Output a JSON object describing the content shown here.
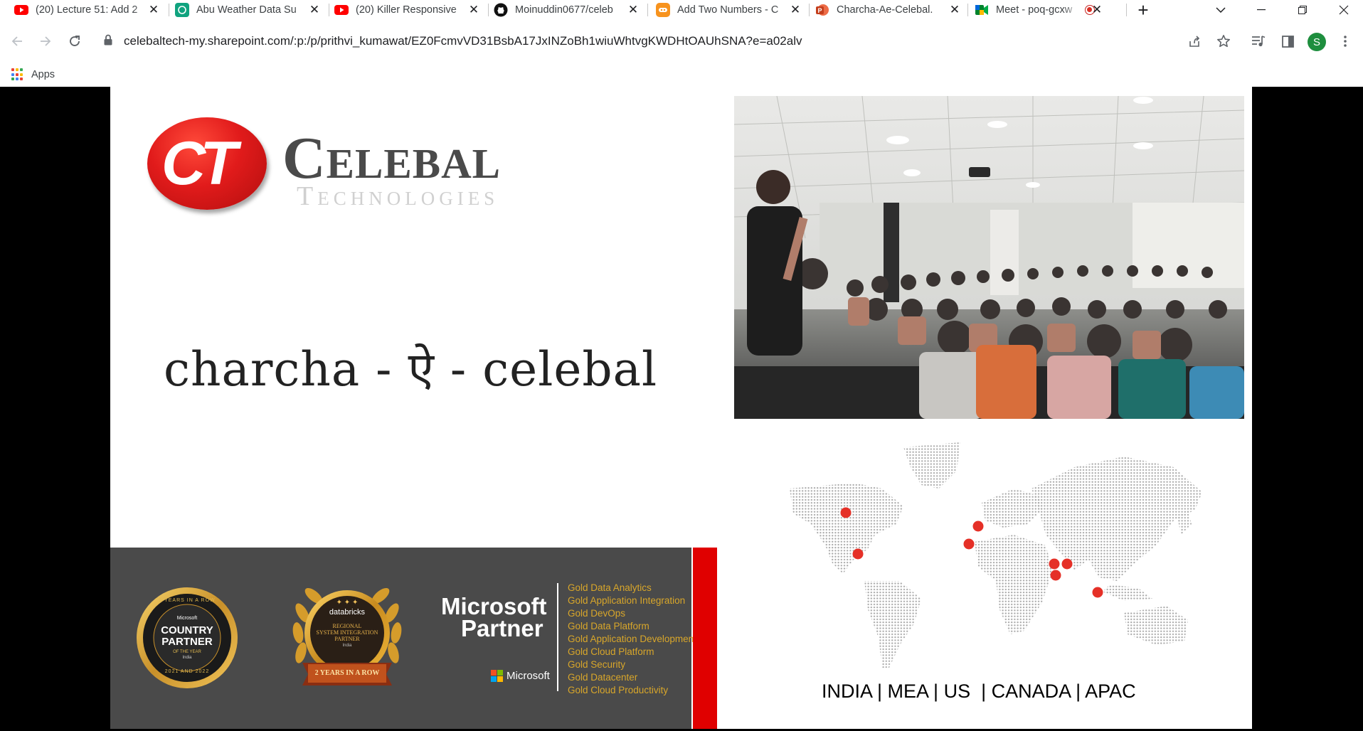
{
  "browser": {
    "tabs": [
      {
        "title": "(20) Lecture 51: Add 2",
        "icon": "youtube-icon"
      },
      {
        "title": "Abu Weather Data Su",
        "icon": "openai-icon"
      },
      {
        "title": "(20) Killer Responsive",
        "icon": "youtube-icon"
      },
      {
        "title": "Moinuddin0677/celeb",
        "icon": "github-icon"
      },
      {
        "title": "Add Two Numbers - C",
        "icon": "codingninjas-icon"
      },
      {
        "title": "Charcha-Ae-Celebal.",
        "icon": "powerpoint-icon"
      },
      {
        "title": "Meet - poq-gcxw",
        "icon": "meet-icon"
      }
    ],
    "url": "celebaltech-my.sharepoint.com/:p:/p/prithvi_kumawat/EZ0FcmvVD31BsbA17JxINZoBh1wiuWhtvgKWDHtOAUhSNA?e=a02alv",
    "profile_initial": "S",
    "bookmarks": {
      "apps_label": "Apps"
    },
    "colors": {
      "youtube": "#ff0000",
      "profile": "#1e8e3e"
    }
  },
  "slide": {
    "logo": {
      "mark": "CT",
      "brand": "Celebal",
      "subtitle": "Technologies"
    },
    "charcha_title": "charcha - ऐ - celebal",
    "badges": {
      "ms_country_partner": {
        "top": "2 YEARS IN A ROW",
        "brand": "Microsoft",
        "title1": "COUNTRY",
        "title2": "PARTNER",
        "sub": "OF THE YEAR",
        "region": "India",
        "bottom": "2021 AND 2022"
      },
      "databricks": {
        "brand": "databricks",
        "l1": "REGIONAL",
        "l2": "SYSTEM INTEGRATION",
        "l3": "PARTNER",
        "region": "India",
        "ribbon": "2 YEARS IN A ROW"
      }
    },
    "microsoft_partner": {
      "line1": "Microsoft",
      "line2": "Partner",
      "ms_logo_text": "Microsoft",
      "competencies": [
        "Gold Data Analytics",
        "Gold Application Integration",
        "Gold DevOps",
        "Gold Data Platform",
        "Gold Application Development",
        "Gold Cloud Platform",
        "Gold Security",
        "Gold Datacenter",
        "Gold Cloud Productivity"
      ]
    },
    "regions": "INDIA | MEA | US  | CANADA | APAC",
    "colors": {
      "accent_red": "#e00000",
      "gold": "#d8a62a",
      "band": "#4a4a4a"
    }
  }
}
